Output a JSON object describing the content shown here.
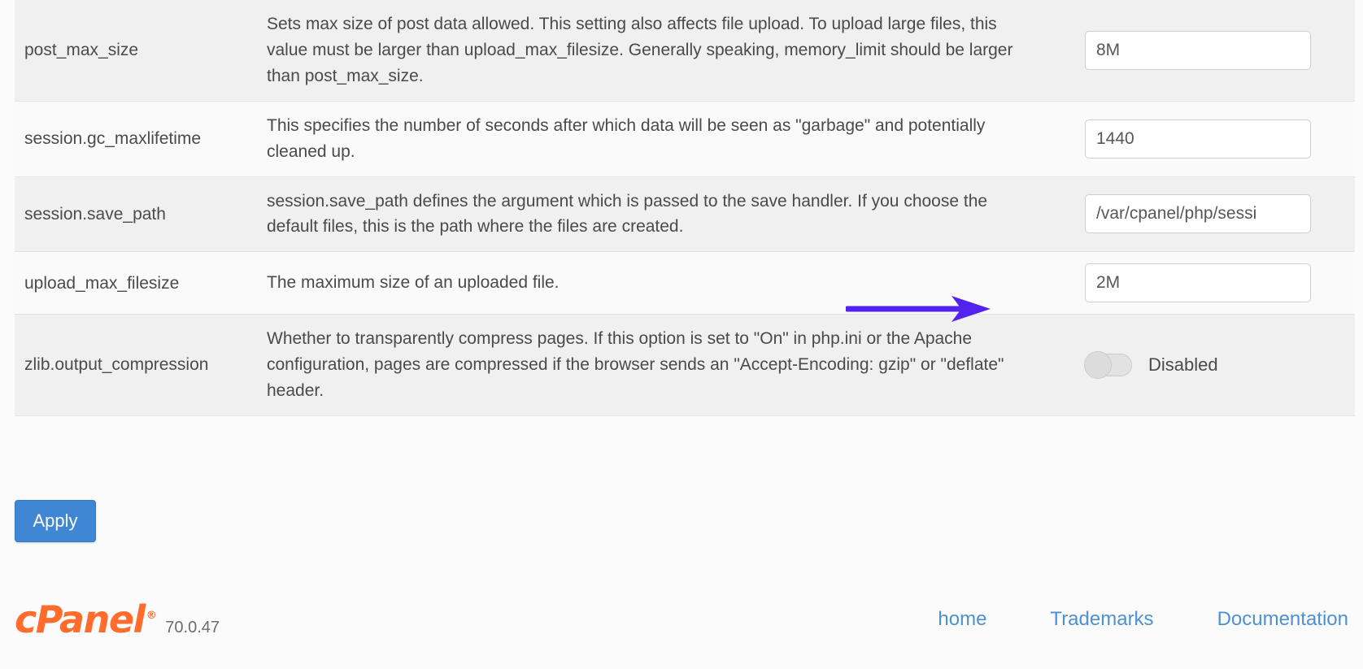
{
  "settings": {
    "rows": [
      {
        "name": "post_max_size",
        "description": "Sets max size of post data allowed. This setting also affects file upload. To upload large files, this value must be larger than upload_max_filesize. Generally speaking, memory_limit should be larger than post_max_size.",
        "control": "input",
        "value": "8M"
      },
      {
        "name": "session.gc_maxlifetime",
        "description": "This specifies the number of seconds after which data will be seen as \"garbage\" and potentially cleaned up.",
        "control": "input",
        "value": "1440"
      },
      {
        "name": "session.save_path",
        "description": "session.save_path defines the argument which is passed to the save handler. If you choose the default files, this is the path where the files are created.",
        "control": "input",
        "value": "/var/cpanel/php/sessi"
      },
      {
        "name": "upload_max_filesize",
        "description": "The maximum size of an uploaded file.",
        "control": "input",
        "value": "2M"
      },
      {
        "name": "zlib.output_compression",
        "description": "Whether to transparently compress pages. If this option is set to \"On\" in php.ini or the Apache configuration, pages are compressed if the browser sends an \"Accept-Encoding: gzip\" or \"deflate\" header.",
        "control": "toggle",
        "value": "Disabled",
        "toggle_state": "off"
      }
    ]
  },
  "actions": {
    "apply_label": "Apply"
  },
  "annotation": {
    "arrow_color": "#5222ef",
    "points_to": "upload_max_filesize"
  },
  "footer": {
    "logo_text": "cPanel",
    "logo_registered": "®",
    "logo_color": "#ff6c2c",
    "version": "70.0.47",
    "links": [
      {
        "label": "home"
      },
      {
        "label": "Trademarks"
      },
      {
        "label": "Documentation"
      }
    ],
    "link_color": "#4e91d0"
  }
}
